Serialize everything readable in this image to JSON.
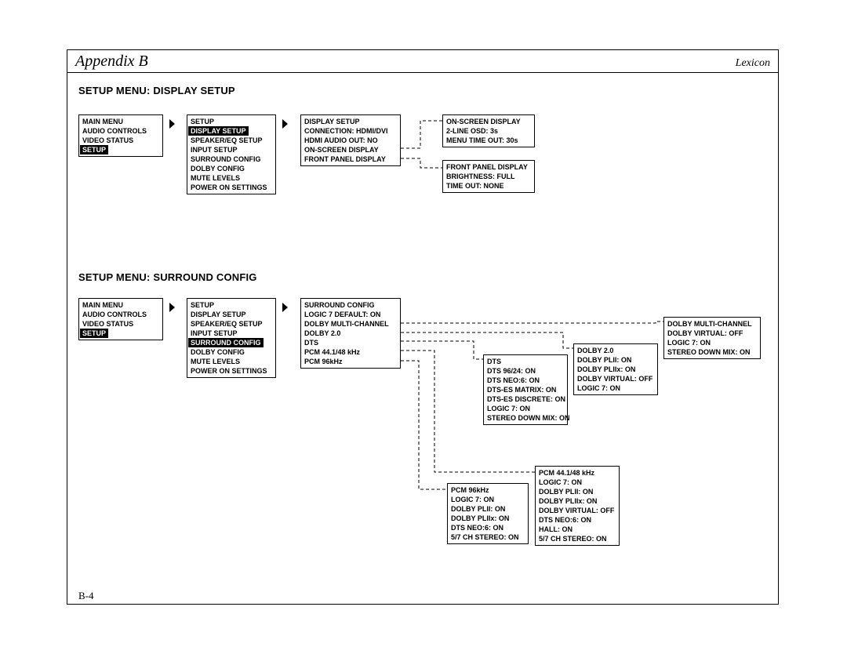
{
  "header": {
    "left": "Appendix B",
    "right": "Lexicon"
  },
  "page_number": "B-4",
  "sec1": {
    "title": "SETUP MENU: DISPLAY SETUP",
    "mainmenu": {
      "r0": "MAIN MENU",
      "r1": "AUDIO CONTROLS",
      "r2": "VIDEO STATUS",
      "r3": "SETUP"
    },
    "setup": {
      "r0": "SETUP",
      "r1": "DISPLAY SETUP",
      "r2": "SPEAKER/EQ SETUP",
      "r3": "INPUT SETUP",
      "r4": "SURROUND CONFIG",
      "r5": "DOLBY CONFIG",
      "r6": "MUTE LEVELS",
      "r7": "POWER ON SETTINGS"
    },
    "display": {
      "r0": "DISPLAY SETUP",
      "r1": "CONNECTION: HDMI/DVI",
      "r2": "HDMI AUDIO OUT: NO",
      "r3": "ON-SCREEN DISPLAY",
      "r4": "FRONT PANEL DISPLAY"
    },
    "osd": {
      "r0": "ON-SCREEN DISPLAY",
      "r1": "2-LINE OSD: 3s",
      "r2": "MENU TIME OUT: 30s"
    },
    "fpd": {
      "r0": "FRONT PANEL DISPLAY",
      "r1": "BRIGHTNESS: FULL",
      "r2": "TIME OUT: NONE"
    }
  },
  "sec2": {
    "title": "SETUP MENU: SURROUND CONFIG",
    "mainmenu": {
      "r0": "MAIN MENU",
      "r1": "AUDIO CONTROLS",
      "r2": "VIDEO STATUS",
      "r3": "SETUP"
    },
    "setup": {
      "r0": "SETUP",
      "r1": "DISPLAY SETUP",
      "r2": "SPEAKER/EQ SETUP",
      "r3": "INPUT SETUP",
      "r4": "SURROUND CONFIG",
      "r5": "DOLBY CONFIG",
      "r6": "MUTE LEVELS",
      "r7": "POWER ON SETTINGS"
    },
    "sc": {
      "r0": "SURROUND CONFIG",
      "r1": "LOGIC 7 DEFAULT: ON",
      "r2": "DOLBY MULTI-CHANNEL",
      "r3": "DOLBY 2.0",
      "r4": "DTS",
      "r5": "PCM 44.1/48 kHz",
      "r6": "PCM 96kHz"
    },
    "dmc": {
      "r0": "DOLBY MULTI-CHANNEL",
      "r1": "DOLBY VIRTUAL: OFF",
      "r2": "LOGIC 7: ON",
      "r3": "STEREO DOWN MIX: ON"
    },
    "d20": {
      "r0": "DOLBY 2.0",
      "r1": "DOLBY PLII: ON",
      "r2": "DOLBY PLIIx: ON",
      "r3": "DOLBY VIRTUAL: OFF",
      "r4": "LOGIC 7: ON"
    },
    "dts": {
      "r0": "DTS",
      "r1": "DTS 96/24: ON",
      "r2": "DTS NEO:6: ON",
      "r3": "DTS-ES MATRIX: ON",
      "r4": "DTS-ES DISCRETE: ON",
      "r5": "LOGIC 7: ON",
      "r6": "STEREO DOWN MIX: ON"
    },
    "pcm44": {
      "r0": "PCM 44.1/48 kHz",
      "r1": "LOGIC 7: ON",
      "r2": "DOLBY PLII: ON",
      "r3": "DOLBY PLIIx: ON",
      "r4": "DOLBY VIRTUAL: OFF",
      "r5": "DTS NEO:6: ON",
      "r6": "HALL: ON",
      "r7": "5/7 CH STEREO: ON"
    },
    "pcm96": {
      "r0": "PCM 96kHz",
      "r1": "LOGIC 7: ON",
      "r2": "DOLBY PLII: ON",
      "r3": "DOLBY PLIIx: ON",
      "r4": "DTS NEO:6: ON",
      "r5": "5/7 CH STEREO: ON"
    }
  }
}
